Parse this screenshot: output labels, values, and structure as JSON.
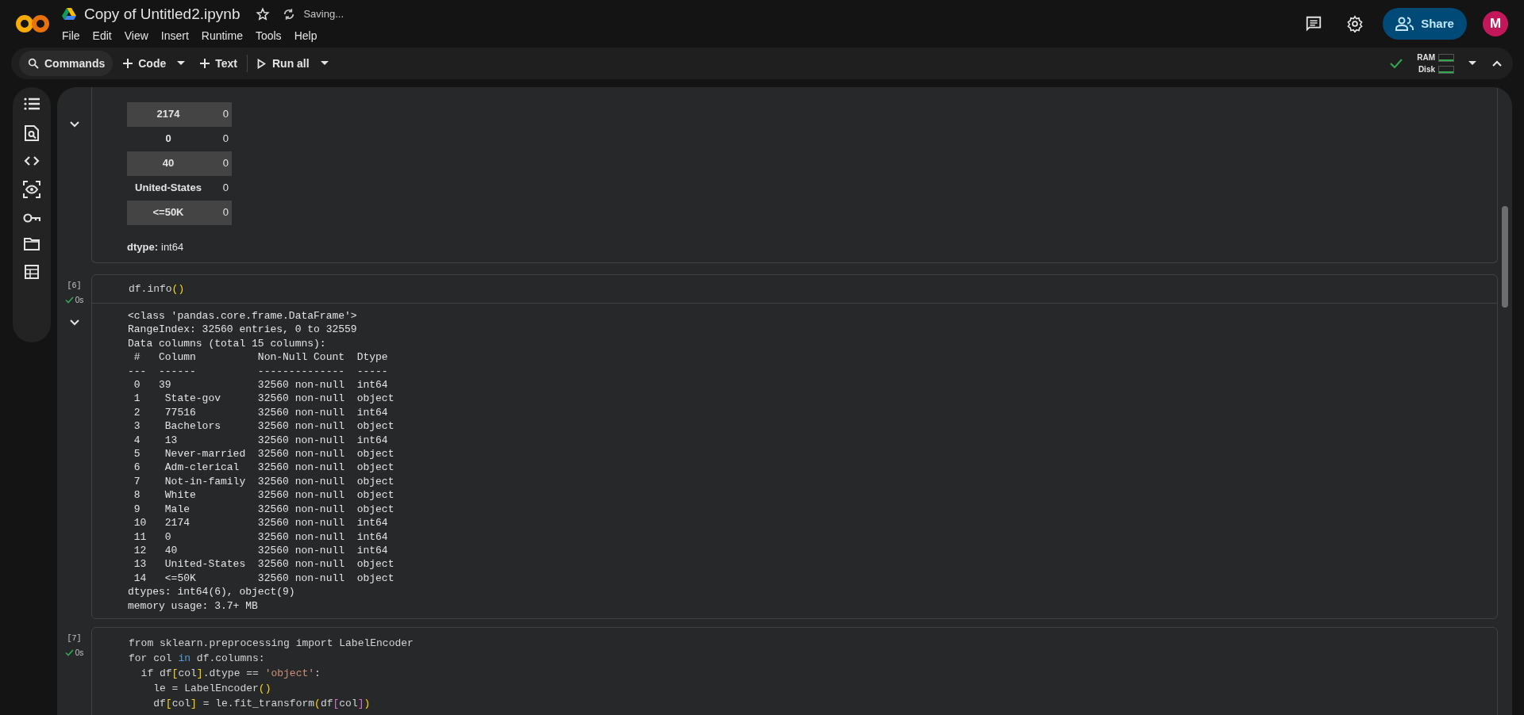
{
  "app": {
    "title": "Copy of Untitled2.ipynb",
    "save_status": "Saving...",
    "menu": [
      "File",
      "Edit",
      "View",
      "Insert",
      "Runtime",
      "Tools",
      "Help"
    ],
    "share": "Share",
    "avatar": "M"
  },
  "toolbar": {
    "commands": "Commands",
    "add_code": "Code",
    "add_text": "Text",
    "run_all": "Run all",
    "resources": [
      "RAM",
      "Disk"
    ]
  },
  "cells": [
    {
      "kind": "output",
      "output": {
        "kind": "series",
        "rows": [
          {
            "label": "2174",
            "value": "0"
          },
          {
            "label": "0",
            "value": "0"
          },
          {
            "label": "40",
            "value": "0"
          },
          {
            "label": "United-States",
            "value": "0"
          },
          {
            "label": "<=50K",
            "value": "0"
          }
        ],
        "dtype_label": "dtype:",
        "dtype": "int64"
      }
    },
    {
      "kind": "code",
      "exec_count": "[6]",
      "duration": "0s",
      "code": [
        [
          {
            "t": "df.info",
            "kind": "plain"
          },
          {
            "t": "()",
            "kind": "bracket1"
          }
        ]
      ],
      "output": {
        "kind": "text",
        "lines": [
          "<class 'pandas.core.frame.DataFrame'>",
          "RangeIndex: 32560 entries, 0 to 32559",
          "Data columns (total 15 columns):",
          " #   Column          Non-Null Count  Dtype",
          "---  ------          --------------  -----",
          " 0   39              32560 non-null  int64",
          " 1    State-gov      32560 non-null  object",
          " 2    77516          32560 non-null  int64",
          " 3    Bachelors      32560 non-null  object",
          " 4    13             32560 non-null  int64",
          " 5    Never-married  32560 non-null  object",
          " 6    Adm-clerical   32560 non-null  object",
          " 7    Not-in-family  32560 non-null  object",
          " 8    White          32560 non-null  object",
          " 9    Male           32560 non-null  object",
          " 10   2174           32560 non-null  int64",
          " 11   0              32560 non-null  int64",
          " 12   40             32560 non-null  int64",
          " 13   United-States  32560 non-null  object",
          " 14   <=50K          32560 non-null  object",
          "dtypes: int64(6), object(9)",
          "memory usage: 3.7+ MB"
        ]
      }
    },
    {
      "kind": "code",
      "exec_count": "[7]",
      "duration": "0s",
      "code": [
        [
          {
            "t": "from sklearn.preprocessing import LabelEncoder",
            "kind": "plain"
          }
        ],
        [
          {
            "t": "for col ",
            "kind": "plain"
          },
          {
            "t": "in",
            "kind": "keyword"
          },
          {
            "t": " df.columns:",
            "kind": "plain"
          }
        ],
        [
          {
            "t": "  if df",
            "kind": "plain"
          },
          {
            "t": "[",
            "kind": "bracket1"
          },
          {
            "t": "col",
            "kind": "plain"
          },
          {
            "t": "]",
            "kind": "bracket1"
          },
          {
            "t": ".dtype == ",
            "kind": "plain"
          },
          {
            "t": "'object'",
            "kind": "string"
          },
          {
            "t": ":",
            "kind": "plain"
          }
        ],
        [
          {
            "t": "    le = LabelEncoder",
            "kind": "plain"
          },
          {
            "t": "()",
            "kind": "bracket1"
          }
        ],
        [
          {
            "t": "    df",
            "kind": "plain"
          },
          {
            "t": "[",
            "kind": "bracket1"
          },
          {
            "t": "col",
            "kind": "plain"
          },
          {
            "t": "]",
            "kind": "bracket1"
          },
          {
            "t": " = le.fit_transform",
            "kind": "plain"
          },
          {
            "t": "(",
            "kind": "bracket1"
          },
          {
            "t": "df",
            "kind": "plain"
          },
          {
            "t": "[",
            "kind": "bracket2"
          },
          {
            "t": "col",
            "kind": "plain"
          },
          {
            "t": "]",
            "kind": "bracket2"
          },
          {
            "t": ")",
            "kind": "bracket1"
          }
        ]
      ]
    }
  ]
}
